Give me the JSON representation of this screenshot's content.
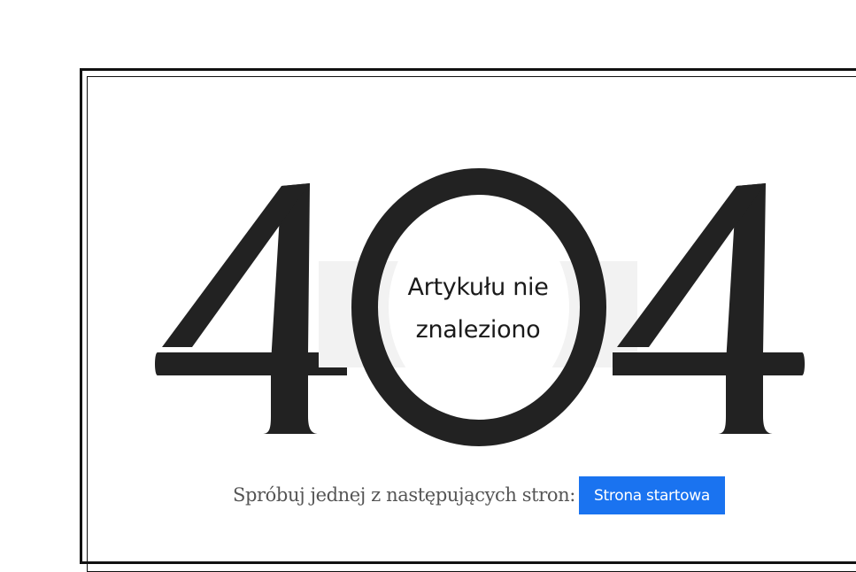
{
  "error": {
    "code_digits": [
      "4",
      "0",
      "4"
    ],
    "title_line_1": "Artykułu nie",
    "title_line_2": "znaleziono"
  },
  "suggestions": {
    "prompt": "Spróbuj jednej z następujących stron:",
    "home_button_label": "Strona startowa"
  },
  "colors": {
    "digit": "#222222",
    "band": "#f2f2f2",
    "button": "#1a73f0",
    "frame": "#111111"
  }
}
